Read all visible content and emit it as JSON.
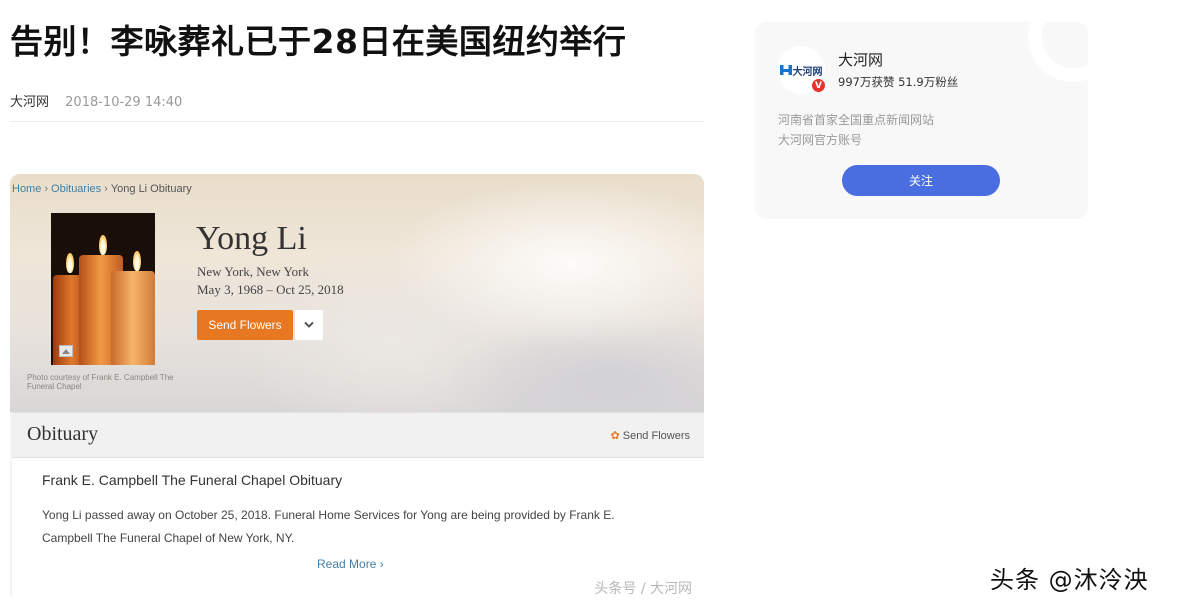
{
  "article": {
    "title": "告别！李咏葬礼已于28日在美国纽约举行",
    "source": "大河网",
    "datetime": "2018-10-29 14:40"
  },
  "embedded": {
    "breadcrumb": {
      "home": "Home",
      "sep": "›",
      "obituaries": "Obituaries",
      "current": "Yong Li Obituary"
    },
    "photo_credit": "Photo courtesy of Frank E. Campbell The Funeral Chapel",
    "name": "Yong Li",
    "location": "New York, New York",
    "dates": "May 3, 1968 – Oct 25, 2018",
    "send_flowers_label": "Send Flowers",
    "obituary_heading": "Obituary",
    "obituary_send_flowers": "Send Flowers",
    "funeral_home_title": "Frank E. Campbell The Funeral Chapel Obituary",
    "obituary_text": "Yong Li passed away on October 25, 2018. Funeral Home Services for Yong are being provided by Frank E. Campbell The Funeral Chapel of New York, NY.",
    "read_more": "Read More ›",
    "watermark": "头条号 / 大河网",
    "icons": {
      "dropdown": "chevron-down-icon",
      "flower": "flower-icon",
      "image": "image-icon"
    }
  },
  "author": {
    "avatar_text": "大河网",
    "name": "大河网",
    "stats": "997万获赞 51.9万粉丝",
    "desc_line1": "河南省首家全国重点新闻网站",
    "desc_line2": "大河网官方账号",
    "verified_badge": "V",
    "follow_label": "关注"
  },
  "page_watermark": "头条 @沐泠泱",
  "colors": {
    "accent": "#4a6ee0",
    "orange": "#e87722",
    "link": "#3f7fa8",
    "badge_red": "#e8322b"
  }
}
